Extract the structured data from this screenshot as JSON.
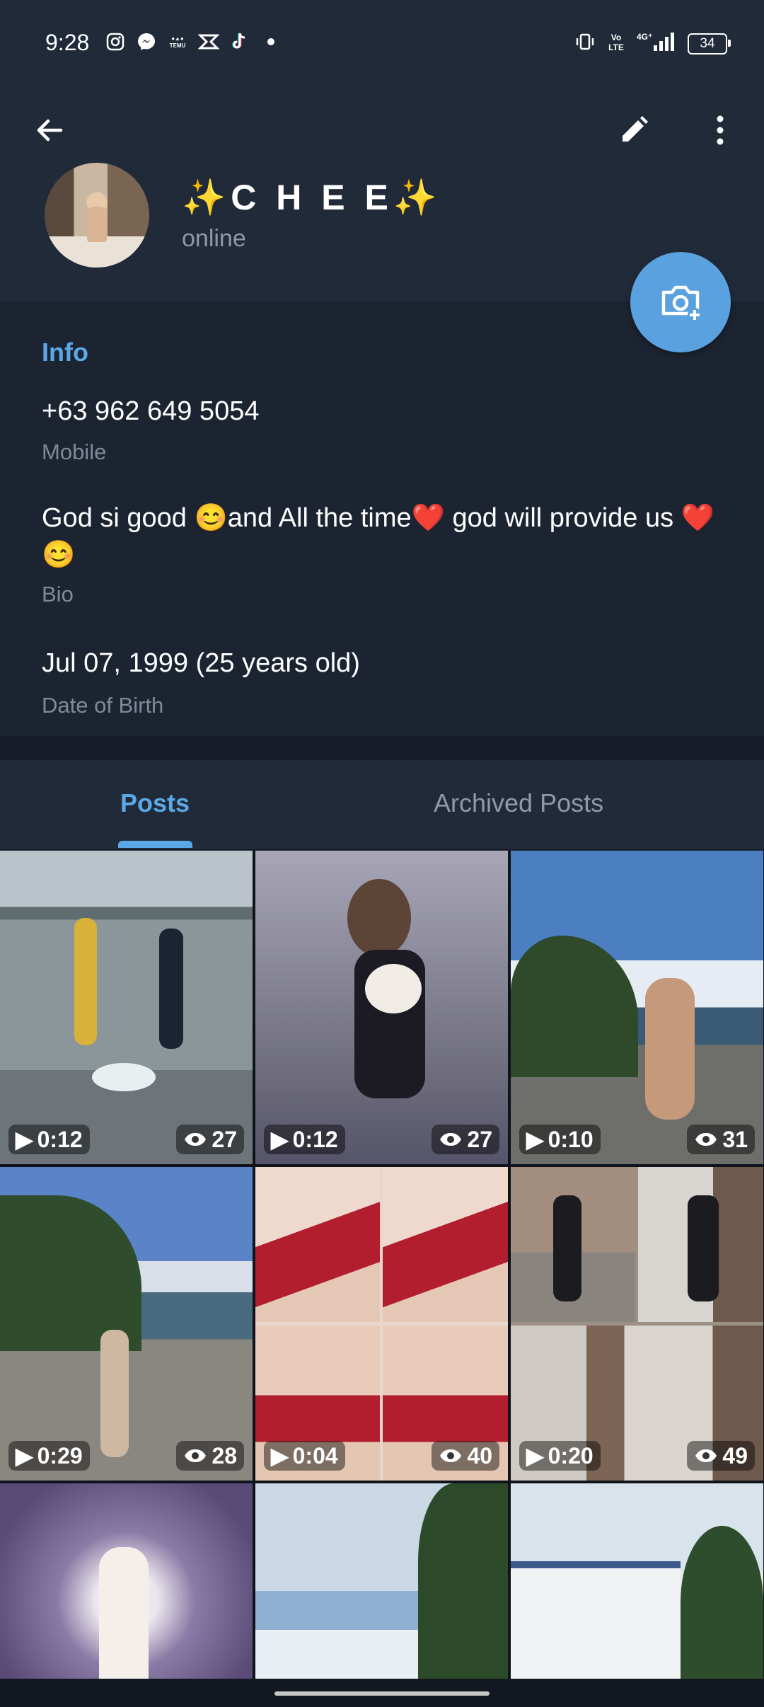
{
  "status_bar": {
    "time": "9:28",
    "apps": [
      "instagram-icon",
      "messenger-icon",
      "temu-icon",
      "capcut-icon",
      "tiktok-icon",
      "dot-icon"
    ],
    "battery": "34"
  },
  "profile": {
    "name": "✨C H E E✨",
    "status": "online"
  },
  "info": {
    "title": "Info",
    "phone": "+63 962 649 5054",
    "phone_label": "Mobile",
    "bio": "God si good 😊and All the time❤️ god will provide us ❤️😊",
    "bio_label": "Bio",
    "birthday": "Jul 07, 1999 (25 years old)",
    "birthday_label": "Date of Birth"
  },
  "tabs": [
    {
      "label": "Posts",
      "active": true
    },
    {
      "label": "Archived Posts",
      "active": false
    }
  ],
  "posts": [
    {
      "duration": "0:12",
      "views": "27"
    },
    {
      "duration": "0:12",
      "views": "27"
    },
    {
      "duration": "0:10",
      "views": "31"
    },
    {
      "duration": "0:29",
      "views": "28"
    },
    {
      "duration": "0:04",
      "views": "40"
    },
    {
      "duration": "0:20",
      "views": "49"
    }
  ],
  "colors": {
    "accent": "#5aa9e6",
    "background": "#1c2431",
    "header": "#212a39"
  }
}
